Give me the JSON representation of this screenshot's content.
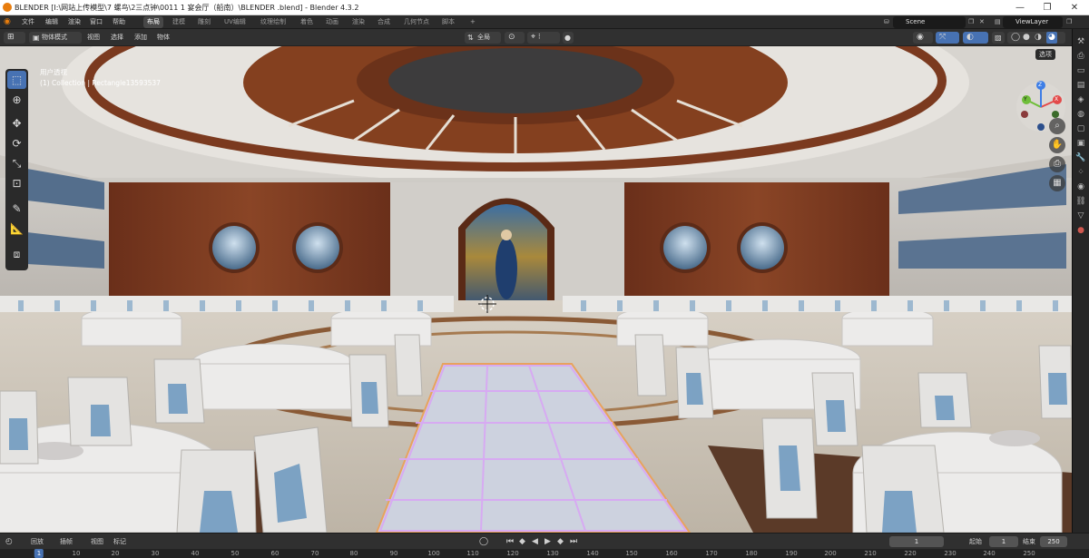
{
  "window": {
    "title": "BLENDER  [I:\\网站上传模型\\7 螺鸟\\2三点钟\\0011 1 宴会厅（船南）\\BLENDER .blend] - Blender 4.3.2",
    "minimize": "—",
    "maximize": "❐",
    "close": "✕"
  },
  "menu": {
    "items": [
      "文件",
      "编辑",
      "渲染",
      "窗口",
      "帮助"
    ],
    "workspaces": [
      "布局",
      "建模",
      "雕刻",
      "UV编辑",
      "纹理绘制",
      "着色",
      "动画",
      "渲染",
      "合成",
      "几何节点",
      "脚本"
    ],
    "active_workspace": "布局",
    "scene": "Scene",
    "view_layer": "ViewLayer"
  },
  "viewport_header": {
    "mode": "物体模式",
    "items": [
      "视图",
      "选择",
      "添加",
      "物体"
    ],
    "transform_orientation": "全局"
  },
  "viewport": {
    "perspective_label": "用户透视",
    "collection_label": "(1) Collection | Rectangle13593537",
    "options_label": "选项",
    "gizmo_axes": {
      "x": "X",
      "y": "Y",
      "z": "Z"
    }
  },
  "icons": {
    "tools": [
      "select-box-icon",
      "cursor-icon",
      "move-icon",
      "rotate-icon",
      "scale-icon",
      "transform-icon",
      "annotate-icon",
      "measure-icon",
      "add-cube-icon"
    ],
    "nav": [
      "zoom-icon",
      "hand-pan-icon",
      "camera-icon",
      "grid-ortho-icon"
    ]
  },
  "timeline": {
    "playback": "回放",
    "keying": "插帧",
    "view": "视图",
    "marker": "标记",
    "current_frame": "1",
    "start_label": "起始",
    "start": "1",
    "end_label": "结束",
    "end": "250",
    "ticks": [
      "1",
      "10",
      "20",
      "30",
      "40",
      "50",
      "60",
      "70",
      "80",
      "90",
      "100",
      "110",
      "120",
      "130",
      "140",
      "150",
      "160",
      "170",
      "180",
      "190",
      "200",
      "210",
      "220",
      "230",
      "240",
      "250"
    ]
  },
  "colors": {
    "accent": "#4772b3",
    "wood": "#7a3a22",
    "wall": "#d9d6d0",
    "cloth": "#e8e8e8",
    "sash": "#5e8fb8",
    "selection": "#d9a6f5"
  }
}
